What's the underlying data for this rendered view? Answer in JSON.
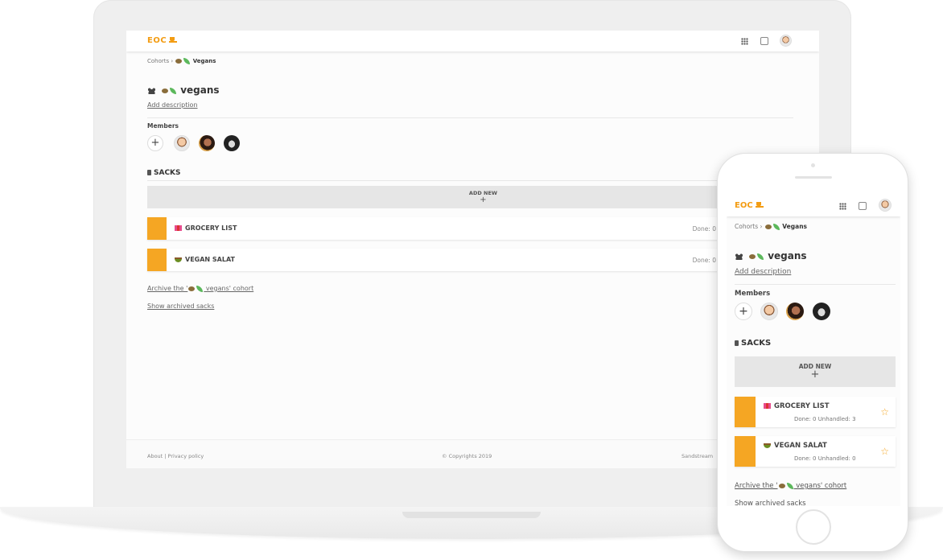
{
  "app": {
    "brand": "EOC"
  },
  "breadcrumb": {
    "root": "Cohorts",
    "separator": "›",
    "current": "Vegans"
  },
  "cohort": {
    "title": "vegans",
    "add_description": "Add description"
  },
  "members": {
    "label": "Members",
    "add_symbol": "+",
    "avatars": [
      "man-avatar",
      "woman-avatar",
      "car-avatar"
    ]
  },
  "sacks": {
    "label": "SACKS",
    "add_new_label": "ADD NEW",
    "add_new_symbol": "+",
    "items": [
      {
        "name": "GROCERY LIST",
        "icon": "books-icon",
        "done_label": "Done: 0",
        "unhandled_label": "Unhandled: 3"
      },
      {
        "name": "VEGAN SALAT",
        "icon": "salad-icon",
        "done_label": "Done: 0",
        "unhandled_label": "Unhandled: 0"
      }
    ]
  },
  "links": {
    "archive_prefix": "Archive the '",
    "archive_name": " vegans' cohort",
    "show_archived": "Show archived sacks"
  },
  "footer": {
    "about": "About | Privacy policy",
    "copyright": "© Copyrights 2019",
    "company": "Sandstream"
  },
  "colors": {
    "brand": "#f39c12",
    "sack_swatch": "#f5a623",
    "add_new_bg": "#e6e6e6"
  }
}
